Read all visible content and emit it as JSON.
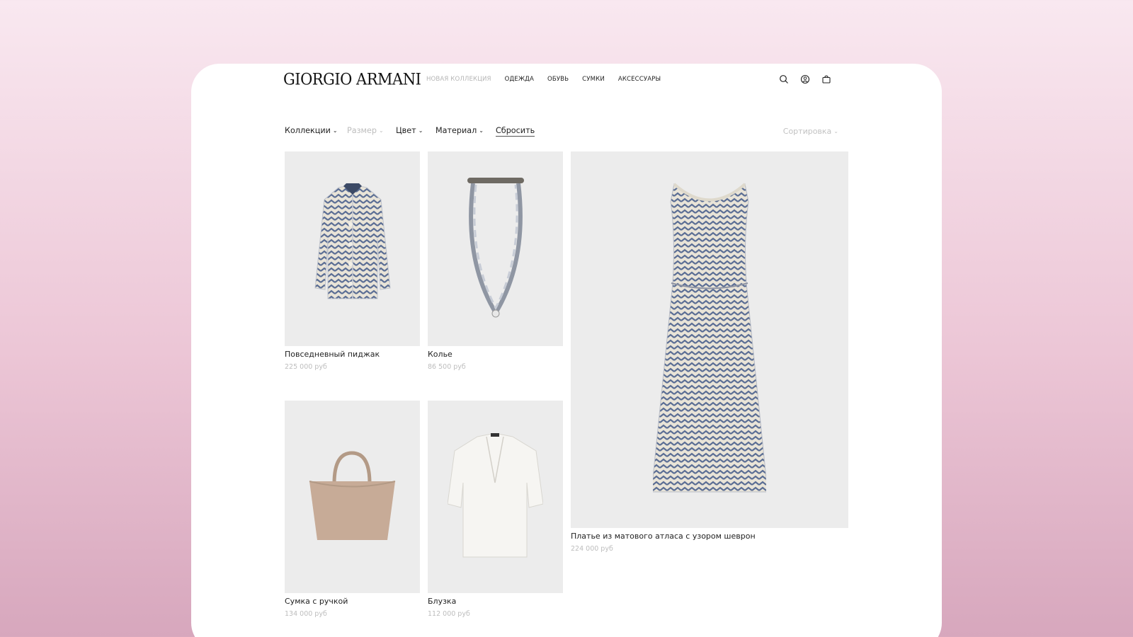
{
  "brand": {
    "logo_text": "GIORGIO ARMANI"
  },
  "nav": [
    {
      "label": "НОВАЯ КОЛЛЕКЦИЯ",
      "muted": true
    },
    {
      "label": "ОДЕЖДА",
      "muted": false
    },
    {
      "label": "ОБУВЬ",
      "muted": false
    },
    {
      "label": "СУМКИ",
      "muted": false
    },
    {
      "label": "АКСЕССУАРЫ",
      "muted": false
    }
  ],
  "icons": [
    "search-icon",
    "user-icon",
    "bag-icon"
  ],
  "filters": {
    "collections": "Коллекции",
    "size": "Размер",
    "color": "Цвет",
    "material": "Материал",
    "reset": "Сбросить",
    "sort": "Сортировка"
  },
  "products": [
    {
      "name": "Повседневный пиджак",
      "price": "225 000 руб",
      "image": "jacket"
    },
    {
      "name": "Колье",
      "price": "86 500 руб",
      "image": "necklace"
    },
    {
      "name": "Платье из матового атласа с узором шеврон",
      "price": "224 000 руб",
      "image": "dress"
    },
    {
      "name": "Сумка с ручкой",
      "price": "134 000 руб",
      "image": "handbag"
    },
    {
      "name": "Блузка",
      "price": "112 000 руб",
      "image": "blouse"
    }
  ],
  "colors": {
    "chevron_blue": "#5a6d94",
    "chevron_cream": "#e9e4d8",
    "card_bg": "#ececec",
    "muted_text": "#bdbdbd",
    "bag": "#c7ab97"
  }
}
